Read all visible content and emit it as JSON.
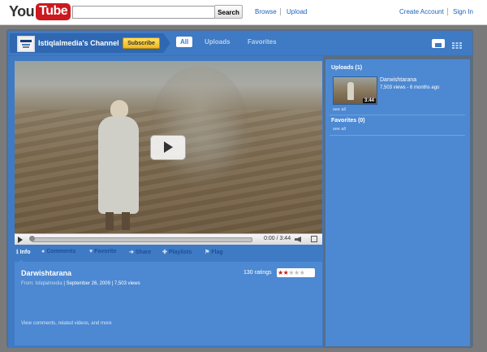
{
  "header": {
    "logo_you": "You",
    "logo_tube": "Tube",
    "search_value": "",
    "search_button": "Search",
    "browse": "Browse",
    "upload": "Upload",
    "create_account": "Create Account",
    "sign_in": "Sign In"
  },
  "channel": {
    "name": "Istiqlalmedia's Channel",
    "subscribe": "Subscribe",
    "tabs": [
      "All",
      "Uploads",
      "Favorites"
    ],
    "active_tab": "All"
  },
  "player": {
    "time": "0:00 / 3:44",
    "progress": 0
  },
  "actions": [
    "Info",
    "Comments",
    "Favorite",
    "Share",
    "Playlists",
    "Flag"
  ],
  "video": {
    "title": "Darwishtarana",
    "from_label": "From:",
    "author": "Istiqlalmedia",
    "date": "September 26, 2009",
    "views": "7,503 views",
    "ratings_text": "130 ratings",
    "rating": 2,
    "rating_max": 5,
    "more": "View comments, related videos, and more"
  },
  "sidebar": {
    "uploads_heading": "Uploads (1)",
    "upload_item": {
      "title": "Darwishtarana",
      "meta": "7,503 views - 6 months ago",
      "duration": "3:44"
    },
    "see_all": "see all",
    "favorites_heading": "Favorites (0)"
  },
  "colors": {
    "channel_bar": "#3f7ac4",
    "panel": "#4d89d2",
    "frame": "#5a6d85",
    "subscribe": "#f3b71a",
    "logo_red": "#cc181e",
    "star_on": "#c61a1a"
  },
  "icons": {
    "play": "play-triangle",
    "volume": "speaker-icon",
    "fullscreen": "fullscreen-icon",
    "info": "info-icon",
    "comments": "speech-bubble-icon",
    "favorite": "heart-icon",
    "share": "arrow-icon",
    "playlists": "plus-icon",
    "flag": "flag-icon"
  }
}
